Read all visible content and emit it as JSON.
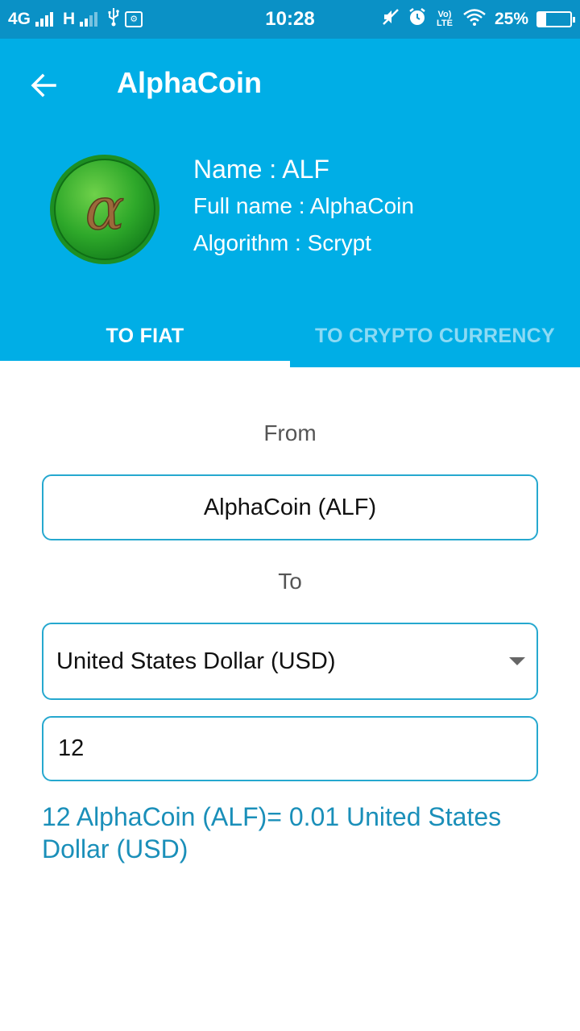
{
  "status_bar": {
    "network_1": "4G",
    "network_2": "H",
    "time": "10:28",
    "volte": "Vo) LTE",
    "battery": "25%",
    "battery_level": 0.25
  },
  "header": {
    "title": "AlphaCoin",
    "logo_glyph": "α",
    "name_line": "Name : ALF",
    "fullname_line": "Full name : AlphaCoin",
    "algorithm_line": "Algorithm : Scrypt"
  },
  "tabs": [
    {
      "label": "TO FIAT",
      "active": true
    },
    {
      "label": "TO CRYPTO CURRENCY",
      "active": false
    }
  ],
  "form": {
    "from_label": "From",
    "from_value": "AlphaCoin (ALF)",
    "to_label": "To",
    "to_value": "United States Dollar (USD)",
    "amount": "12",
    "result": "12 AlphaCoin (ALF)= 0.01 United States Dollar (USD)"
  },
  "colors": {
    "header_bg": "#00aee6",
    "status_bg": "#0a91c6",
    "accent": "#26a8cf",
    "result_text": "#1a8fb9"
  },
  "icons": [
    "back-arrow-icon",
    "alphacoin-logo",
    "dropdown-arrow-icon",
    "usb-icon",
    "mute-icon",
    "alarm-icon",
    "wifi-icon",
    "battery-icon"
  ]
}
